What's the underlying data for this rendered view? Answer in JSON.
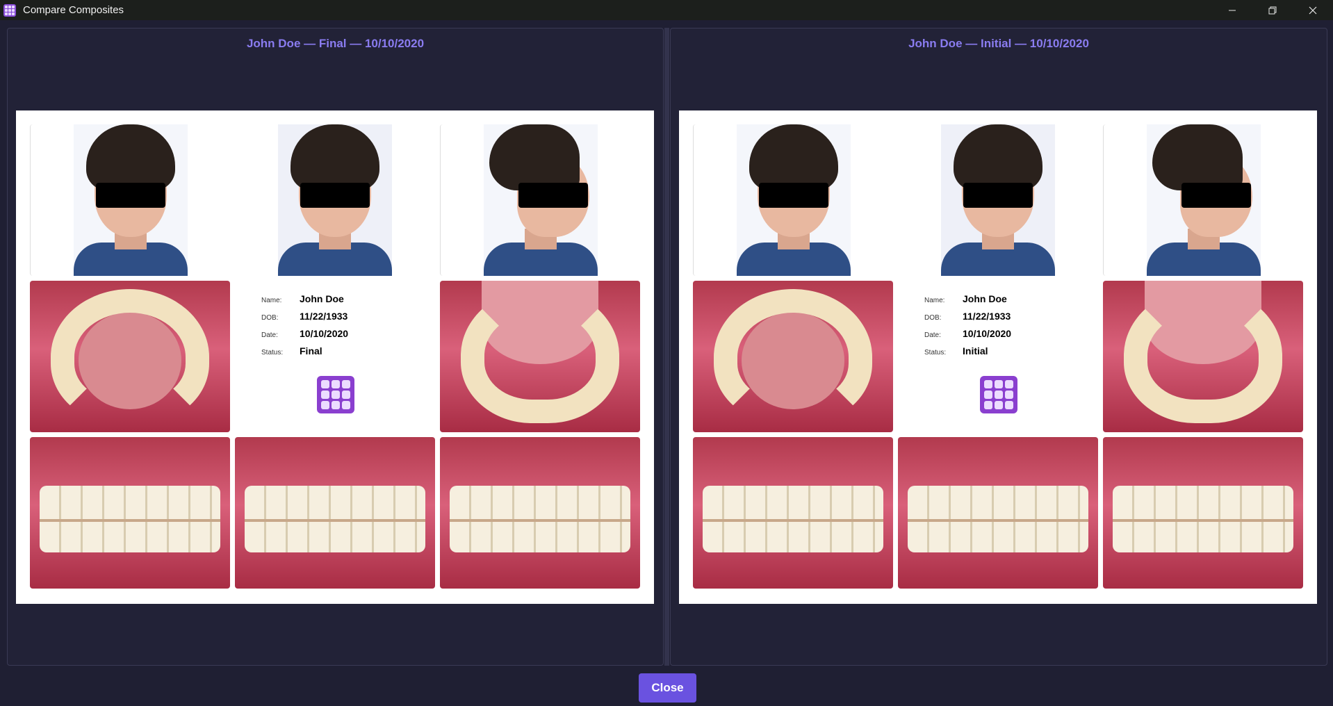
{
  "window": {
    "title": "Compare Composites",
    "icon": "grid-app-icon",
    "controls": [
      "minimize",
      "restore",
      "close"
    ]
  },
  "panels": [
    {
      "title": "John Doe — Final — 10/10/2020",
      "info": {
        "name_label": "Name:",
        "name": "John Doe",
        "dob_label": "DOB:",
        "dob": "11/22/1933",
        "date_label": "Date:",
        "date": "10/10/2020",
        "status_label": "Status:",
        "status": "Final"
      }
    },
    {
      "title": "John Doe — Initial — 10/10/2020",
      "info": {
        "name_label": "Name:",
        "name": "John Doe",
        "dob_label": "DOB:",
        "dob": "11/22/1933",
        "date_label": "Date:",
        "date": "10/10/2020",
        "status_label": "Status:",
        "status": "Initial"
      }
    }
  ],
  "footer": {
    "close_label": "Close"
  },
  "colors": {
    "accent": "#6a52e0",
    "title": "#8a7cf0",
    "background": "#1f1f33"
  }
}
